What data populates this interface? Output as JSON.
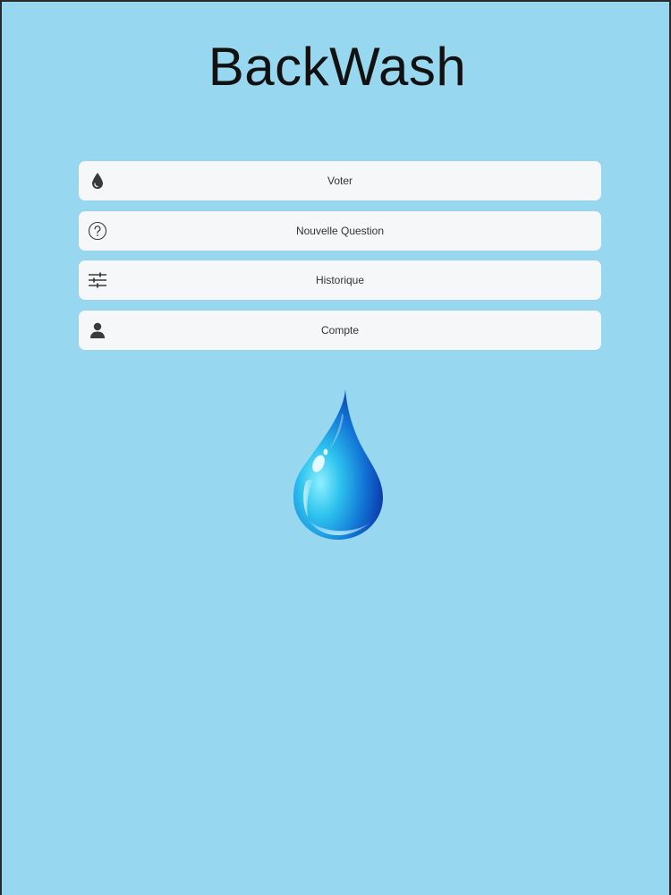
{
  "app": {
    "title": "BackWash"
  },
  "menu": {
    "items": [
      {
        "id": "voter",
        "label": "Voter",
        "icon": "water-drop-icon"
      },
      {
        "id": "nouvelle-question",
        "label": "Nouvelle Question",
        "icon": "question-circle-icon"
      },
      {
        "id": "historique",
        "label": "Historique",
        "icon": "sliders-icon"
      },
      {
        "id": "compte",
        "label": "Compte",
        "icon": "person-icon"
      }
    ]
  },
  "colors": {
    "background": "#98d7f0",
    "button_background": "#f5f7f8",
    "icon_color": "#3a3a3a",
    "title_color": "#111111",
    "drop_light": "#4fd2f4",
    "drop_dark": "#0a3fb5"
  }
}
